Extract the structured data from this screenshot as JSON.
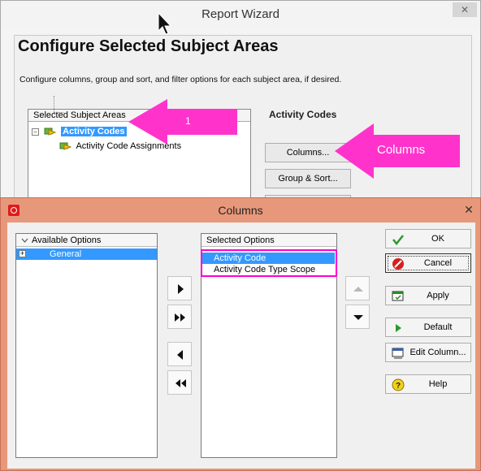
{
  "wizard": {
    "title": "Report Wizard",
    "close_glyph": "✕",
    "heading": "Configure Selected Subject Areas",
    "description": "Configure columns, group and sort, and filter options for each subject area, if desired.",
    "tree_header": "Selected Subject Areas",
    "tree_items": [
      {
        "label": "Activity Codes",
        "selected": true,
        "expander": "−"
      },
      {
        "label": "Activity Code Assignments"
      }
    ],
    "right_label": "Activity Codes",
    "buttons": {
      "columns": "Columns...",
      "group_sort": "Group & Sort...",
      "filter": ""
    }
  },
  "annotations": {
    "callout_1": "1",
    "callout_2": "Columns",
    "color": "#ff33cc"
  },
  "dialog": {
    "title": "Columns",
    "close_glyph": "✕",
    "available_header": "Available Options",
    "available_items": [
      {
        "label": "General",
        "expander": "+"
      }
    ],
    "selected_header": "Selected Options",
    "selected_items": [
      {
        "label": "Activity Code",
        "selected": true
      },
      {
        "label": "Activity Code Type Scope",
        "selected": false
      }
    ],
    "buttons": {
      "ok": "OK",
      "cancel": "Cancel",
      "apply": "Apply",
      "default": "Default",
      "edit_column": "Edit Column...",
      "help": "Help"
    },
    "icons": {
      "add": "arrow-right-icon",
      "add_all": "double-arrow-right-icon",
      "remove": "arrow-left-icon",
      "remove_all": "double-arrow-left-icon",
      "up": "arrow-up-icon",
      "down": "arrow-down-icon"
    }
  },
  "colors": {
    "selection": "#3399ff",
    "dialog_frame": "#e8987a",
    "highlight": "#ff00cc"
  }
}
